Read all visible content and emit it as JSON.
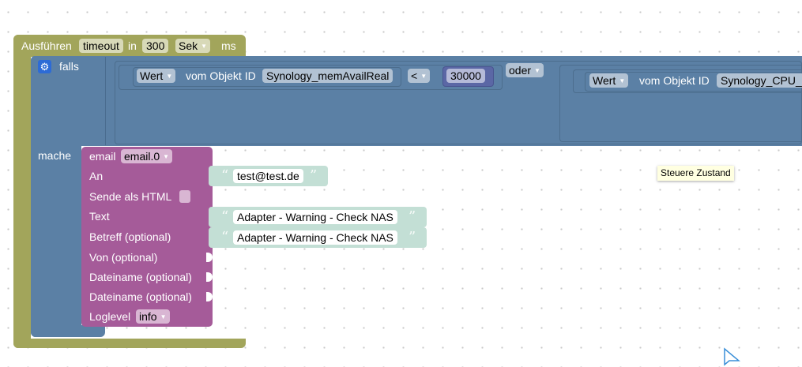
{
  "colors": {
    "timeout_block": "#a2a55b",
    "if_block": "#5b80a5",
    "email_block": "#a55b99",
    "text_block": "#5ba58c"
  },
  "timeout": {
    "label_run": "Ausführen",
    "name": "timeout",
    "label_in": "in",
    "delay": "300",
    "unit": "Sek",
    "label_ms": "ms"
  },
  "if_block": {
    "label_if": "falls",
    "label_do": "mache",
    "gear_icon": "gear-icon",
    "condition1": {
      "attr": "Wert",
      "label_of_object": "vom Objekt ID",
      "object_id": "Synology_memAvailReal",
      "operator": "<",
      "value": "30000"
    },
    "logic_op": "oder",
    "condition2": {
      "attr": "Wert",
      "label_of_object": "vom Objekt ID",
      "object_id": "Synology_CPU_"
    }
  },
  "email": {
    "label": "email",
    "instance": "email.0",
    "to_label": "An",
    "to_value": "test@test.de",
    "html_label": "Sende als HTML",
    "text_label": "Text",
    "text_value": "Adapter - Warning - Check NAS",
    "subject_label": "Betreff (optional)",
    "subject_value": "Adapter - Warning - Check NAS",
    "from_label": "Von (optional)",
    "file1_label": "Dateiname (optional)",
    "file2_label": "Dateiname (optional)",
    "loglevel_label": "Loglevel",
    "loglevel_value": "info"
  },
  "tooltip": "Steuere Zustand"
}
